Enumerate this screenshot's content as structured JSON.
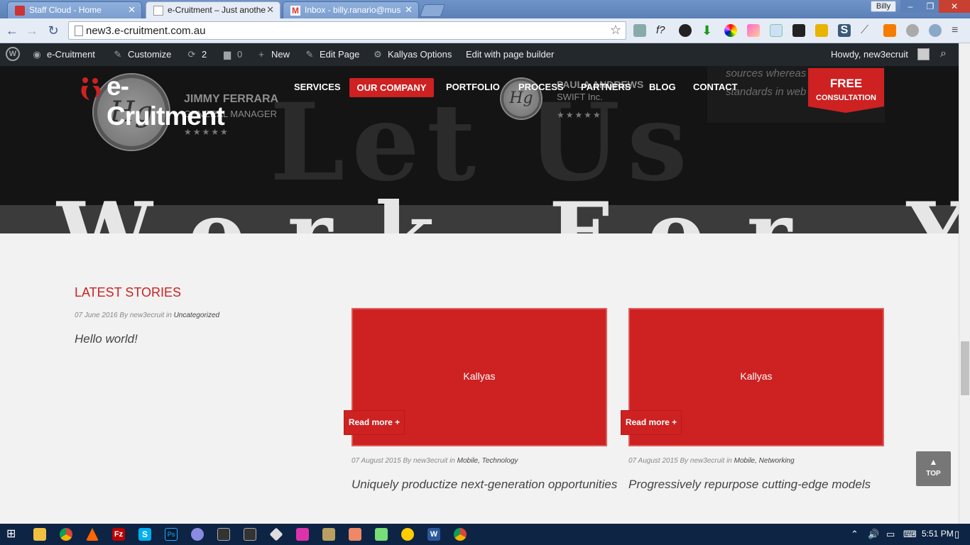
{
  "browser": {
    "tabs": [
      {
        "label": "Staff Cloud - Home",
        "favicon": "red-doc-icon",
        "active": false
      },
      {
        "label": "e-Cruitment – Just anothe",
        "favicon": "page-icon",
        "active": true
      },
      {
        "label": "Inbox - billy.ranario@mus",
        "favicon": "gmail-icon",
        "active": false
      }
    ],
    "user_badge": "Billy",
    "url": "new3.e-cruitment.com.au"
  },
  "wp_admin_bar": {
    "site_name": "e-Cruitment",
    "customize": "Customize",
    "updates_count": "2",
    "comments_count": "0",
    "new": "New",
    "edit_page": "Edit Page",
    "kallyas_options": "Kallyas Options",
    "edit_builder": "Edit with page builder",
    "howdy": "Howdy, new3ecruit"
  },
  "header": {
    "logo_text": "e-Cruitment",
    "nav": [
      "SERVICES",
      "OUR COMPANY",
      "PORTFOLIO",
      "PROCESS",
      "PARTNERS",
      "BLOG",
      "CONTACT"
    ],
    "active_nav": "OUR COMPANY",
    "cta_line1": "FREE",
    "cta_line2": "CONSULTATION"
  },
  "hero": {
    "chalk_text_top": "Let Us",
    "chalk_text_bottom": "Work For You",
    "quote_fragment": "sources whereas high standards in web",
    "testimonials": [
      {
        "name": "JIMMY FERRARA",
        "role": "GENERAL MANAGER",
        "stars": "★★★★★",
        "avatar_text": "Hg"
      },
      {
        "name": "PAULA ANDREWS",
        "role": "SWIFT Inc.",
        "stars": "★★★★★",
        "avatar_text": "Hg"
      }
    ]
  },
  "latest": {
    "heading": "LATEST STORIES",
    "posts": [
      {
        "date": "07 June 2016",
        "by": "By",
        "author": "new3ecruit",
        "in": "in",
        "cats": "Uncategorized",
        "title": "Hello world!"
      },
      {
        "date": "07 August 2015",
        "by": "By",
        "author": "new3ecruit",
        "in": "in",
        "cats": "Mobile, Technology",
        "title": "Uniquely productize next-generation opportunities",
        "image_label": "Kallyas",
        "read_more": "Read more +"
      },
      {
        "date": "07 August 2015",
        "by": "By",
        "author": "new3ecruit",
        "in": "in",
        "cats": "Mobile, Networking",
        "title": "Progressively repurpose cutting-edge models",
        "image_label": "Kallyas",
        "read_more": "Read more +"
      }
    ]
  },
  "to_top": "TOP",
  "taskbar": {
    "time": "5:51 PM"
  },
  "colors": {
    "brand_red": "#cd2122",
    "admin_bar": "#23282d",
    "taskbar": "#0d2445"
  }
}
